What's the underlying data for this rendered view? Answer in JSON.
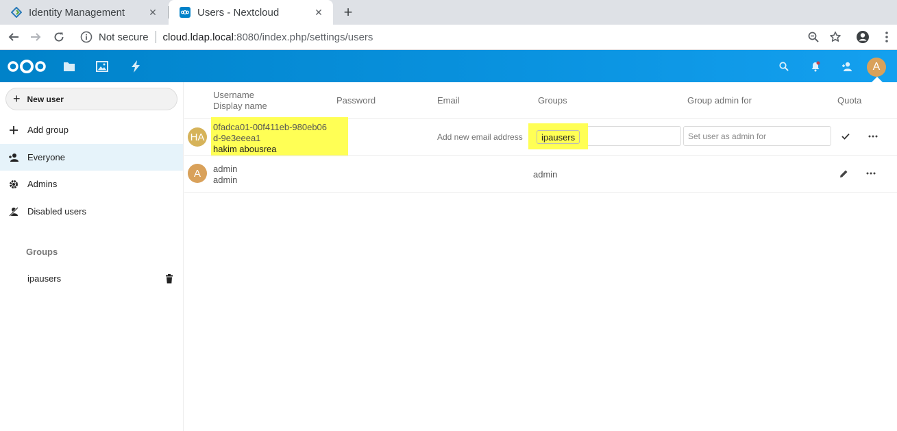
{
  "browser": {
    "tabs": [
      {
        "title": "Identity Management",
        "favicon": "freeipa-icon"
      },
      {
        "title": "Users - Nextcloud",
        "favicon": "nextcloud-icon",
        "active": true
      }
    ],
    "security_label": "Not secure",
    "url_host": "cloud.ldap.local",
    "url_path": ":8080/index.php/settings/users"
  },
  "header": {
    "apps": [
      "files-icon",
      "photos-icon",
      "activity-icon"
    ],
    "right_icons": [
      "search-icon",
      "notifications-icon",
      "contacts-icon"
    ],
    "avatar_initial": "A",
    "brand_color": "#0082c9"
  },
  "sidebar": {
    "new_user_label": "New user",
    "add_group_label": "Add group",
    "items": [
      {
        "label": "Everyone",
        "icon": "user-icon",
        "active": true
      },
      {
        "label": "Admins",
        "icon": "gear-icon"
      },
      {
        "label": "Disabled users",
        "icon": "disabled-user-icon"
      }
    ],
    "groups_caption": "Groups",
    "groups": [
      {
        "label": "ipausers"
      }
    ]
  },
  "table": {
    "headers": {
      "username": "Username",
      "display_name": "Display name",
      "password": "Password",
      "email": "Email",
      "groups": "Groups",
      "group_admin": "Group admin for",
      "quota": "Quota"
    },
    "rows": [
      {
        "avatar": "HA",
        "avatar_color": "#d6b35a",
        "username_line1": "0fadca01-00f411eb-980eb06",
        "username_line2": "d-9e3eeea1",
        "display_name": "hakim abousrea",
        "email_placeholder": "Add new email address",
        "group_tag": "ipausers",
        "group_admin_placeholder": "Set user as admin for",
        "editing": true
      },
      {
        "avatar": "A",
        "avatar_color": "#d9a15a",
        "username": "admin",
        "display_name": "admin",
        "groups": "admin",
        "editing": false
      }
    ]
  }
}
